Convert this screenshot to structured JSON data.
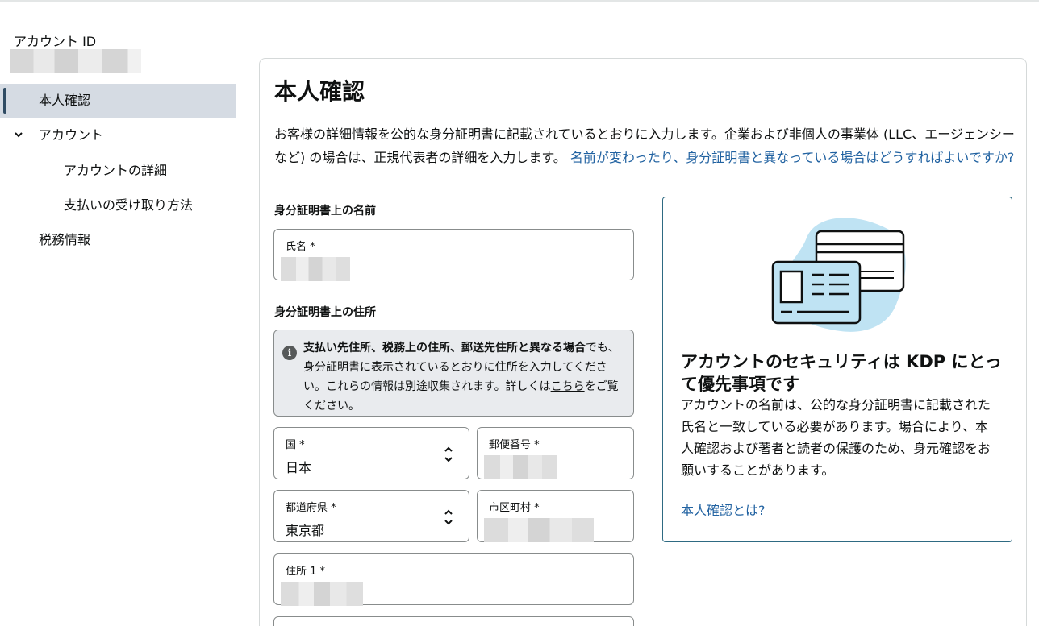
{
  "sidebar": {
    "account_label": "アカウント ID",
    "items": [
      {
        "label": "本人確認",
        "active": true
      },
      {
        "label": "アカウント",
        "expanded": true
      },
      {
        "label": "アカウントの詳細"
      },
      {
        "label": "支払いの受け取り方法"
      },
      {
        "label": "税務情報"
      }
    ]
  },
  "main": {
    "title": "本人確認",
    "description": "お客様の詳細情報を公的な身分証明書に記載されているとおりに入力します。企業および非個人の事業体 (LLC、エージェンシーなど) の場合は、正規代表者の詳細を入力します。",
    "description_link": "名前が変わったり、身分証明書と異なっている場合はどうすればよいですか?",
    "name_section": "身分証明書上の名前",
    "name_label": "氏名 *",
    "address_section": "身分証明書上の住所",
    "alert": {
      "bold": "支払い先住所、税務上の住所、郵送先住所と異なる場合",
      "text1": "でも、身分証明書に表示されているとおりに住所を入力してください。これらの情報は別途収集されます。詳しくは",
      "link": "こちら",
      "text2": "をご覧ください。"
    },
    "country": {
      "label": "国 *",
      "value": "日本"
    },
    "postal": {
      "label": "郵便番号 *"
    },
    "prefecture": {
      "label": "都道府県 *",
      "value": "東京都"
    },
    "city": {
      "label": "市区町村 *"
    },
    "address1": {
      "label": "住所 1 *"
    }
  },
  "info": {
    "title": "アカウントのセキュリティは KDP にとって優先事項です",
    "body": "アカウントの名前は、公的な身分証明書に記載された氏名と一致している必要があります。場合により、本人確認および著者と読者の保護のため、身元確認をお願いすることがあります。",
    "link": "本人確認とは?"
  },
  "colors": {
    "link": "#2162a1",
    "info_border": "#2e6a82",
    "illustration_blob": "#bfe3f3",
    "active_nav": "#d5dbe3"
  }
}
